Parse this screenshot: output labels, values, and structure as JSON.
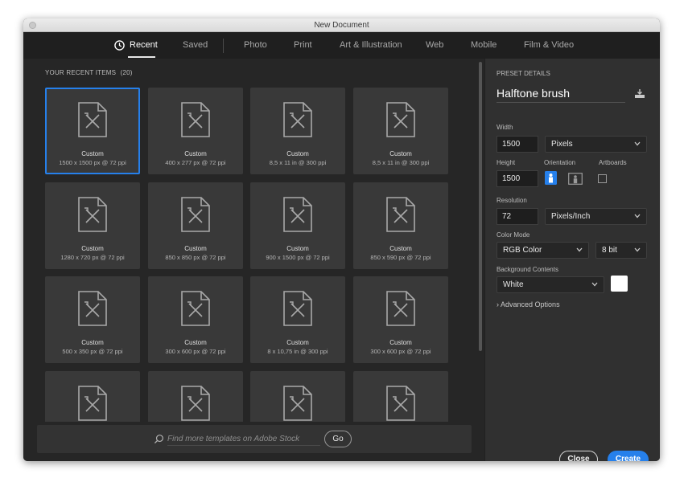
{
  "window": {
    "title": "New Document"
  },
  "tabs": [
    {
      "label": "Recent",
      "active": true
    },
    {
      "label": "Saved"
    },
    {
      "label": "Photo"
    },
    {
      "label": "Print"
    },
    {
      "label": "Art & Illustration"
    },
    {
      "label": "Web"
    },
    {
      "label": "Mobile"
    },
    {
      "label": "Film & Video"
    }
  ],
  "recent": {
    "heading": "YOUR RECENT ITEMS",
    "count": "(20)",
    "items": [
      {
        "name": "Custom",
        "size": "1500 x 1500 px @ 72 ppi",
        "selected": true
      },
      {
        "name": "Custom",
        "size": "400 x 277 px @ 72 ppi"
      },
      {
        "name": "Custom",
        "size": "8,5 x 11 in @ 300 ppi"
      },
      {
        "name": "Custom",
        "size": "8,5 x 11 in @ 300 ppi"
      },
      {
        "name": "Custom",
        "size": "1280 x 720 px @ 72 ppi"
      },
      {
        "name": "Custom",
        "size": "850 x 850 px @ 72 ppi"
      },
      {
        "name": "Custom",
        "size": "900 x 1500 px @ 72 ppi"
      },
      {
        "name": "Custom",
        "size": "850 x 590 px @ 72 ppi"
      },
      {
        "name": "Custom",
        "size": "500 x 350 px @ 72 ppi"
      },
      {
        "name": "Custom",
        "size": "300 x 600 px @ 72 ppi"
      },
      {
        "name": "Custom",
        "size": "8 x 10,75 in @ 300 ppi"
      },
      {
        "name": "Custom",
        "size": "300 x 600 px @ 72 ppi"
      },
      {
        "name": "",
        "size": ""
      },
      {
        "name": "",
        "size": ""
      },
      {
        "name": "",
        "size": ""
      },
      {
        "name": "",
        "size": ""
      }
    ]
  },
  "stock": {
    "placeholder": "Find more templates on Adobe Stock",
    "go_label": "Go"
  },
  "preset": {
    "heading": "PRESET DETAILS",
    "name": "Halftone brush",
    "width_label": "Width",
    "width_value": "1500",
    "width_unit": "Pixels",
    "height_label": "Height",
    "height_value": "1500",
    "orientation_label": "Orientation",
    "artboards_label": "Artboards",
    "resolution_label": "Resolution",
    "resolution_value": "72",
    "resolution_unit": "Pixels/Inch",
    "color_mode_label": "Color Mode",
    "color_mode": "RGB Color",
    "bit_depth": "8 bit",
    "background_label": "Background Contents",
    "background": "White",
    "background_swatch": "#ffffff",
    "advanced_label": "Advanced Options"
  },
  "actions": {
    "close_label": "Close",
    "create_label": "Create"
  },
  "colors": {
    "accent": "#2680eb",
    "panel": "#303030",
    "tile": "#393939"
  }
}
